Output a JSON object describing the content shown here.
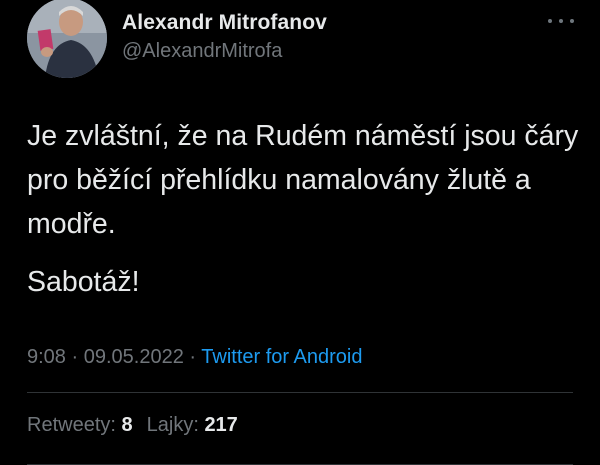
{
  "author": {
    "name": "Alexandr Mitrofanov",
    "handle": "@AlexandrMitrofa"
  },
  "tweet": {
    "paragraphs": [
      "Je zvláštní, že na Rudém náměstí jsou čáry pro běžící přehlídku namalovány žlutě a modře.",
      "Sabotáž!"
    ],
    "time": "9:08",
    "separator": "·",
    "date": "09.05.2022",
    "source": "Twitter for Android"
  },
  "stats": {
    "retweets_label": "Retweety:",
    "retweets_count": "8",
    "likes_label": "Lajky:",
    "likes_count": "217"
  },
  "icons": {
    "more": "more-horizontal-icon"
  },
  "colors": {
    "background": "#000000",
    "primary_text": "#e7e9ea",
    "secondary_text": "#71767b",
    "link": "#1d9bf0",
    "divider": "#2f3336"
  }
}
